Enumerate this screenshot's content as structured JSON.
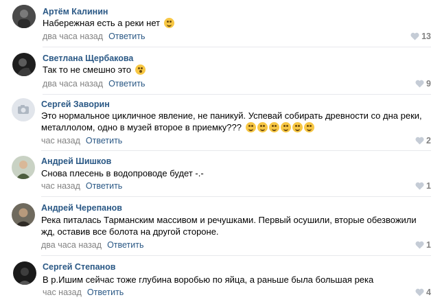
{
  "comments": [
    {
      "author": "Артём Калинин",
      "text": "Набережная есть а реки нет",
      "time": "два часа назад",
      "reply": "Ответить",
      "likes": "13",
      "emoji": [
        "laugh"
      ]
    },
    {
      "author": "Светлана Щербакова",
      "text": "Так то не смешно это",
      "time": "два часа назад",
      "reply": "Ответить",
      "likes": "9",
      "emoji": [
        "wow"
      ]
    },
    {
      "author": "Сергей Заворин",
      "text_line1": "Это нормальное цикличное явление, не паникуй. Успевай собирать древности со дна реки,",
      "text_line2": "металлолом, одно в музей второе в приемку???",
      "time": "час назад",
      "reply": "Ответить",
      "likes": "2",
      "emoji": [
        "grin",
        "grin",
        "grin",
        "laugh",
        "laugh",
        "laugh"
      ]
    },
    {
      "author": "Андрей Шишков",
      "text": "Снова плесень в водопроводе будет -.-",
      "time": "час назад",
      "reply": "Ответить",
      "likes": "1"
    },
    {
      "author": "Андрей Черепанов",
      "text_line1": "Река питалась Тарманским массивом и речушками. Первый осушили, вторые обезвожили",
      "text_line2": "жд, оставив все болота на другой стороне.",
      "time": "два часа назад",
      "reply": "Ответить",
      "likes": "1"
    },
    {
      "author": "Сергей Степанов",
      "text": "В р.Ишим сейчас тоже глубина воробью по яйца, а раньше была большая река",
      "time": "час назад",
      "reply": "Ответить",
      "likes": "4"
    }
  ],
  "colors": {
    "link": "#2a5885",
    "meta": "#828282",
    "separator": "#e7e8ec"
  }
}
